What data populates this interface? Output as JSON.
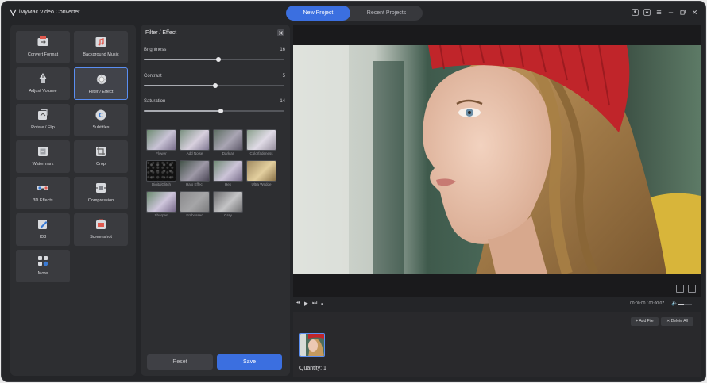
{
  "app": {
    "title": "iMyMac Video Converter"
  },
  "tabs": [
    "New Project",
    "Recent Projects"
  ],
  "tools": [
    {
      "label": "Convert Format",
      "icon": "convert-format-icon"
    },
    {
      "label": "Background Music",
      "icon": "background-music-icon"
    },
    {
      "label": "Adjust Volume",
      "icon": "adjust-volume-icon"
    },
    {
      "label": "Filter / Effect",
      "icon": "filter-effect-icon",
      "active": true
    },
    {
      "label": "Rotate / Flip",
      "icon": "rotate-flip-icon"
    },
    {
      "label": "Subtitles",
      "icon": "subtitles-icon"
    },
    {
      "label": "Watermark",
      "icon": "watermark-icon"
    },
    {
      "label": "Crop",
      "icon": "crop-icon"
    },
    {
      "label": "3D Effects",
      "icon": "3d-effects-icon"
    },
    {
      "label": "Compression",
      "icon": "compression-icon"
    },
    {
      "label": "ID3",
      "icon": "id3-icon"
    },
    {
      "label": "Screenshot",
      "icon": "screenshot-icon"
    },
    {
      "label": "More",
      "icon": "more-icon"
    }
  ],
  "filter_panel": {
    "title": "Filter / Effect",
    "sliders": [
      {
        "label": "Brightness",
        "value": "16",
        "level": 0.53
      },
      {
        "label": "Contrast",
        "value": "5",
        "level": 0.51
      },
      {
        "label": "Saturation",
        "value": "14",
        "level": 0.55
      }
    ],
    "filters": [
      "Flower",
      "Add Noise",
      "Darklar",
      "Colorfadeness",
      "DigitalGlitch",
      "Halo Effect",
      "Hex",
      "Ultra Wedde",
      "Sharpen",
      "Embossed",
      "Gray"
    ],
    "reset_label": "Reset",
    "save_label": "Save"
  },
  "player": {
    "time": "00:00:00 / 00:00:07",
    "volume_level": 0.4
  },
  "files": {
    "add_file_label": "+ Add File",
    "delete_all_label": "✕ Delete All",
    "quantity_text": "Quantity: 1"
  },
  "colors": {
    "accent": "#3b6fe0",
    "panel": "#2d2e31",
    "background": "#242528"
  }
}
